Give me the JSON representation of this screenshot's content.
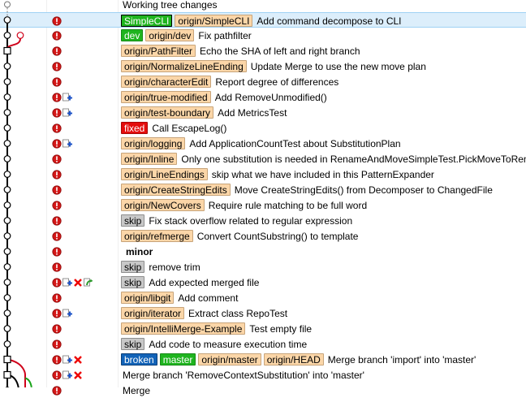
{
  "colors": {
    "remote_badge": "#fbd6a8",
    "local_badge": "#1fb41f",
    "fixed_badge": "#e40d0d",
    "skip_badge": "#c8c8c8",
    "broken_badge": "#1263b8",
    "selection": "#dceefb",
    "graph_main": "#000000",
    "graph_branch_red": "#d0021b",
    "graph_branch_green": "#17a317"
  },
  "rows": [
    {
      "refs": [],
      "message": "Working tree changes",
      "icons": []
    },
    {
      "refs": [
        {
          "kind": "local-head",
          "text": "SimpleCLI"
        },
        {
          "kind": "remote",
          "text": "origin/SimpleCLI"
        }
      ],
      "message": "Add command decompose to CLI",
      "icons": [
        "conflict-icon"
      ],
      "selected": true
    },
    {
      "refs": [
        {
          "kind": "local",
          "text": "dev"
        },
        {
          "kind": "remote",
          "text": "origin/dev"
        }
      ],
      "message": "Fix pathfilter",
      "icons": [
        "conflict-icon"
      ]
    },
    {
      "refs": [
        {
          "kind": "remote",
          "text": "origin/PathFilter"
        }
      ],
      "message": "Echo the SHA of left and right branch",
      "icons": [
        "conflict-icon"
      ]
    },
    {
      "refs": [
        {
          "kind": "remote",
          "text": "origin/NormalizeLineEnding"
        }
      ],
      "message": "Update Merge to use the new move plan",
      "icons": [
        "conflict-icon"
      ]
    },
    {
      "refs": [
        {
          "kind": "remote",
          "text": "origin/characterEdit"
        }
      ],
      "message": "Report degree of differences",
      "icons": [
        "conflict-icon"
      ]
    },
    {
      "refs": [
        {
          "kind": "remote",
          "text": "origin/true-modified"
        }
      ],
      "message": "Add RemoveUnmodified()",
      "icons": [
        "conflict-icon",
        "added-icon"
      ]
    },
    {
      "refs": [
        {
          "kind": "remote",
          "text": "origin/test-boundary"
        }
      ],
      "message": "Add MetricsTest",
      "icons": [
        "conflict-icon",
        "added-icon"
      ]
    },
    {
      "refs": [
        {
          "kind": "fixed",
          "text": "fixed"
        }
      ],
      "message": "Call EscapeLog()",
      "icons": [
        "conflict-icon"
      ]
    },
    {
      "refs": [
        {
          "kind": "remote",
          "text": "origin/logging"
        }
      ],
      "message": "Add ApplicationCountTest about SubstitutionPlan",
      "icons": [
        "conflict-icon",
        "added-icon"
      ]
    },
    {
      "refs": [
        {
          "kind": "remote",
          "text": "origin/Inline"
        }
      ],
      "message": "Only one substitution is needed in RenameAndMoveSimpleTest.PickMoveToRename",
      "icons": [
        "conflict-icon"
      ]
    },
    {
      "refs": [
        {
          "kind": "remote",
          "text": "origin/LineEndings"
        }
      ],
      "message": "skip what we have included in this PatternExpander",
      "icons": [
        "conflict-icon"
      ]
    },
    {
      "refs": [
        {
          "kind": "remote",
          "text": "origin/CreateStringEdits"
        }
      ],
      "message": "Move CreateStringEdits() from Decomposer to ChangedFile",
      "icons": [
        "conflict-icon"
      ]
    },
    {
      "refs": [
        {
          "kind": "remote",
          "text": "origin/NewCovers"
        }
      ],
      "message": "Require rule matching to be full word",
      "icons": [
        "conflict-icon"
      ]
    },
    {
      "refs": [
        {
          "kind": "skip",
          "text": "skip"
        }
      ],
      "message": "Fix stack overflow related to regular expression",
      "icons": [
        "conflict-icon"
      ]
    },
    {
      "refs": [
        {
          "kind": "remote",
          "text": "origin/refmerge"
        }
      ],
      "message": "Convert CountSubstring() to template",
      "icons": [
        "conflict-icon"
      ]
    },
    {
      "refs": [],
      "message": "minor",
      "bold": true,
      "icons": [
        "conflict-icon"
      ]
    },
    {
      "refs": [
        {
          "kind": "skip",
          "text": "skip"
        }
      ],
      "message": "remove trim",
      "icons": [
        "conflict-icon"
      ]
    },
    {
      "refs": [
        {
          "kind": "skip",
          "text": "skip"
        }
      ],
      "message": "Add expected merged file",
      "icons": [
        "conflict-icon",
        "added-icon",
        "deleted-icon",
        "renamed-icon"
      ]
    },
    {
      "refs": [
        {
          "kind": "remote",
          "text": "origin/libgit"
        }
      ],
      "message": "Add comment",
      "icons": [
        "conflict-icon"
      ]
    },
    {
      "refs": [
        {
          "kind": "remote",
          "text": "origin/iterator"
        }
      ],
      "message": "Extract class RepoTest",
      "icons": [
        "conflict-icon",
        "added-icon"
      ]
    },
    {
      "refs": [
        {
          "kind": "remote",
          "text": "origin/IntelliMerge-Example"
        }
      ],
      "message": "Test empty file",
      "icons": [
        "conflict-icon"
      ]
    },
    {
      "refs": [
        {
          "kind": "skip",
          "text": "skip"
        }
      ],
      "message": "Add code to measure execution time",
      "icons": [
        "conflict-icon"
      ]
    },
    {
      "refs": [
        {
          "kind": "broken",
          "text": "broken"
        },
        {
          "kind": "local",
          "text": "master"
        },
        {
          "kind": "remote",
          "text": "origin/master"
        },
        {
          "kind": "remote",
          "text": "origin/HEAD"
        }
      ],
      "message": "Merge branch 'import' into 'master'",
      "icons": [
        "conflict-icon",
        "added-icon",
        "deleted-icon"
      ]
    },
    {
      "refs": [],
      "message": "Merge branch 'RemoveContextSubstitution' into 'master'",
      "icons": [
        "conflict-icon",
        "added-icon",
        "deleted-icon"
      ]
    },
    {
      "refs": [],
      "message": "Merge",
      "icons": [
        "conflict-icon"
      ]
    }
  ]
}
